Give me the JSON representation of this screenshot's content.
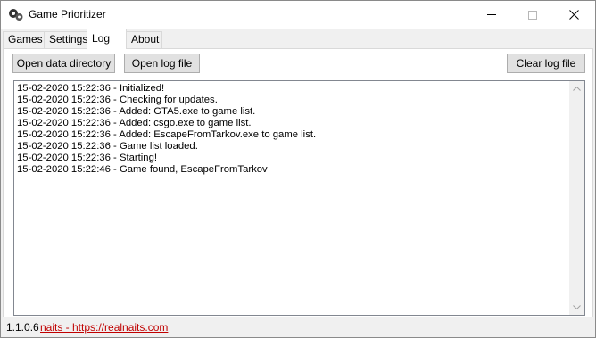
{
  "window": {
    "title": "Game Prioritizer"
  },
  "tabs": [
    {
      "label": "Games",
      "active": false
    },
    {
      "label": "Settings",
      "active": false
    },
    {
      "label": "Log",
      "active": true
    },
    {
      "label": "About",
      "active": false
    }
  ],
  "log_panel": {
    "open_dir_label": "Open data directory",
    "open_log_label": "Open log file",
    "clear_log_label": "Clear log file",
    "lines": [
      "15-02-2020 15:22:36 - Initialized!",
      "15-02-2020 15:22:36 - Checking for updates.",
      "15-02-2020 15:22:36 - Added: GTA5.exe to game list.",
      "15-02-2020 15:22:36 - Added: csgo.exe to game list.",
      "15-02-2020 15:22:36 - Added: EscapeFromTarkov.exe to game list.",
      "15-02-2020 15:22:36 - Game list loaded.",
      "15-02-2020 15:22:36 - Starting!",
      "15-02-2020 15:22:46 - Game found, EscapeFromTarkov"
    ]
  },
  "status": {
    "version": "1.1.0.6",
    "link_text": "naits - https://realnaits.com"
  },
  "colors": {
    "link": "#c00000",
    "panel": "#ffffff",
    "chrome": "#f0f0f0"
  }
}
